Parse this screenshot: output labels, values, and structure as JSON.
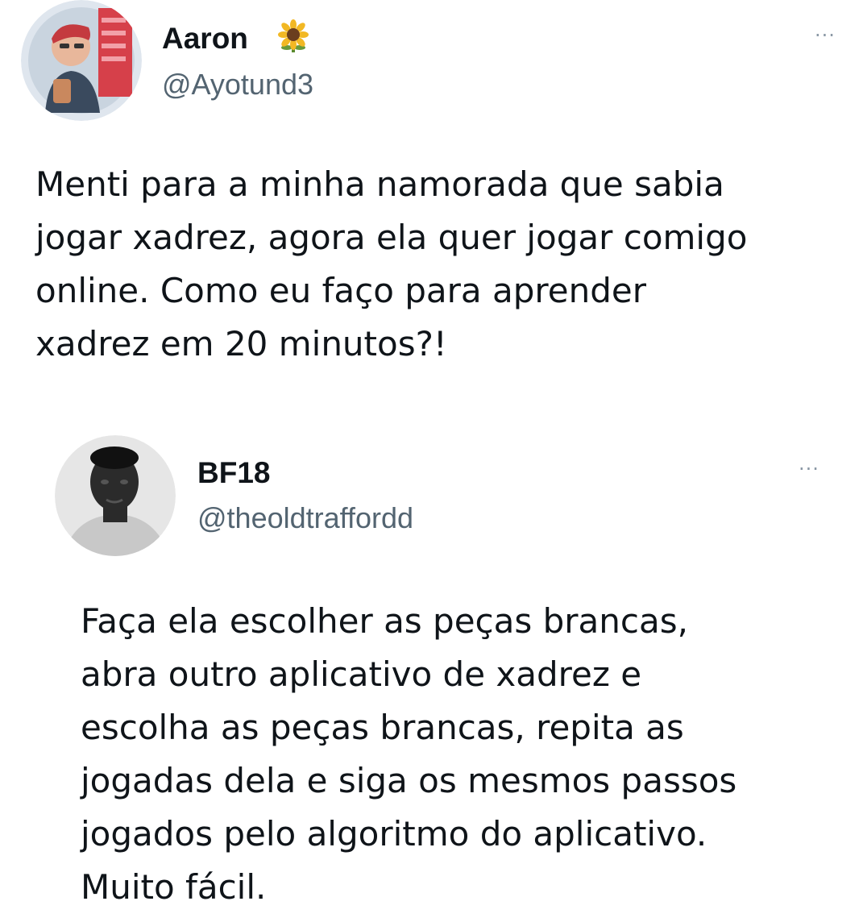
{
  "tweet": {
    "author_name": "Aaron",
    "author_handle": "@Ayotund3",
    "name_emoji": "sunflower-icon",
    "more_label": "···",
    "text_lines": [
      "Menti para a minha namorada que sabia",
      "jogar xadrez, agora ela quer jogar comigo",
      "online. Como eu faço para aprender",
      "xadrez em 20 minutos?!"
    ]
  },
  "reply": {
    "author_name": "BF18",
    "author_handle": "@theoldtraffordd",
    "more_label": "···",
    "text_lines": [
      "Faça ela escolher as peças brancas,",
      "abra outro aplicativo de xadrez e",
      "escolha as peças brancas, repita as",
      "jogadas dela e siga os mesmos passos",
      "jogados pelo algoritmo do aplicativo.",
      "Muito fácil."
    ]
  },
  "colors": {
    "text": "#0f1419",
    "secondary": "#536471",
    "background": "#ffffff"
  }
}
